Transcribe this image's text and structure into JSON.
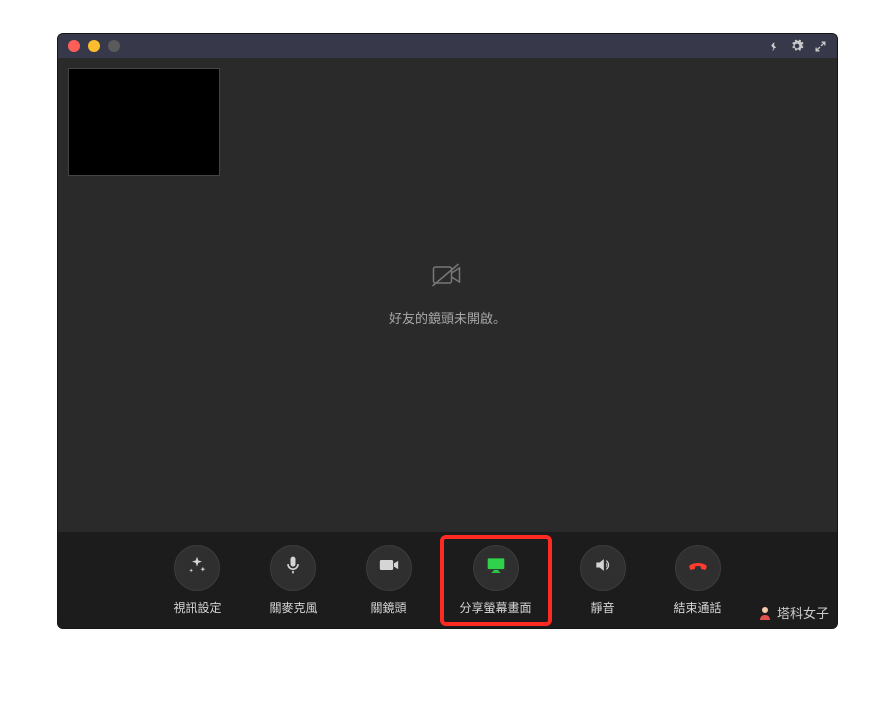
{
  "titlebar": {
    "icons": {
      "pin": "pin-icon",
      "gear": "gear-icon",
      "expand": "expand-icon"
    }
  },
  "center_message": "好友的鏡頭未開啟。",
  "controls": {
    "video_settings": "視訊設定",
    "mute_mic": "關麥克風",
    "camera_off": "關鏡頭",
    "share_screen": "分享螢幕畫面",
    "mute_speaker": "靜音",
    "end_call": "結束通話"
  },
  "colors": {
    "share_icon": "#2fd24a",
    "end_icon": "#ff3b30",
    "highlight": "#ff2a22"
  },
  "watermark": "塔科女子"
}
